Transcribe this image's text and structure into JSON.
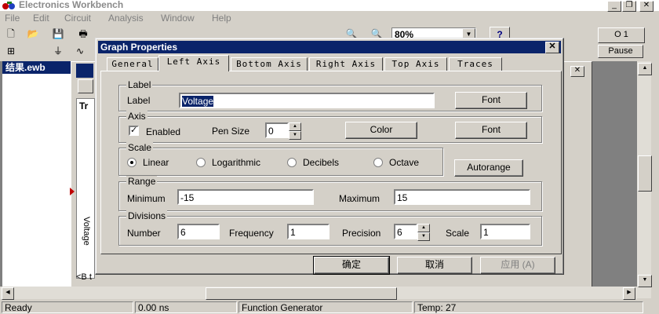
{
  "app": {
    "title": "Electronics Workbench"
  },
  "menu": [
    "File",
    "Edit",
    "Circuit",
    "Analysis",
    "Window",
    "Help"
  ],
  "toolbar": {
    "zoom": "80%",
    "help": "?",
    "pause": "Pause",
    "power": "O 1"
  },
  "child_window": {
    "title": "结果.ewb",
    "panel_letter": "Tr",
    "axis_text": "Voltage",
    "bottom_text": "<B t"
  },
  "status": {
    "ready": "Ready",
    "time": "0.00 ns",
    "component": "Function Generator",
    "temp": "Temp:  27"
  },
  "dialog": {
    "title": "Graph Properties",
    "tabs": [
      "General",
      "Left Axis",
      "Bottom Axis",
      "Right Axis",
      "Top Axis",
      "Traces"
    ],
    "active_tab": "Left Axis",
    "label_group": {
      "title": "Label",
      "label": "Label",
      "value": "Voltage",
      "font_button": "Font"
    },
    "axis_group": {
      "title": "Axis",
      "enabled_label": "Enabled",
      "enabled": true,
      "pen_size_label": "Pen Size",
      "pen_size": "0",
      "color_button": "Color",
      "font_button": "Font"
    },
    "scale_group": {
      "title": "Scale",
      "options": [
        "Linear",
        "Logarithmic",
        "Decibels",
        "Octave"
      ],
      "selected": "Linear",
      "autorange_button": "Autorange"
    },
    "range_group": {
      "title": "Range",
      "min_label": "Minimum",
      "min": "-15",
      "max_label": "Maximum",
      "max": "15"
    },
    "divisions_group": {
      "title": "Divisions",
      "number_label": "Number",
      "number": "6",
      "frequency_label": "Frequency",
      "frequency": "1",
      "precision_label": "Precision",
      "precision": "6",
      "scale_label": "Scale",
      "scale": "1"
    },
    "buttons": {
      "ok": "确定",
      "cancel": "取消",
      "apply": "应用 (A)"
    }
  }
}
